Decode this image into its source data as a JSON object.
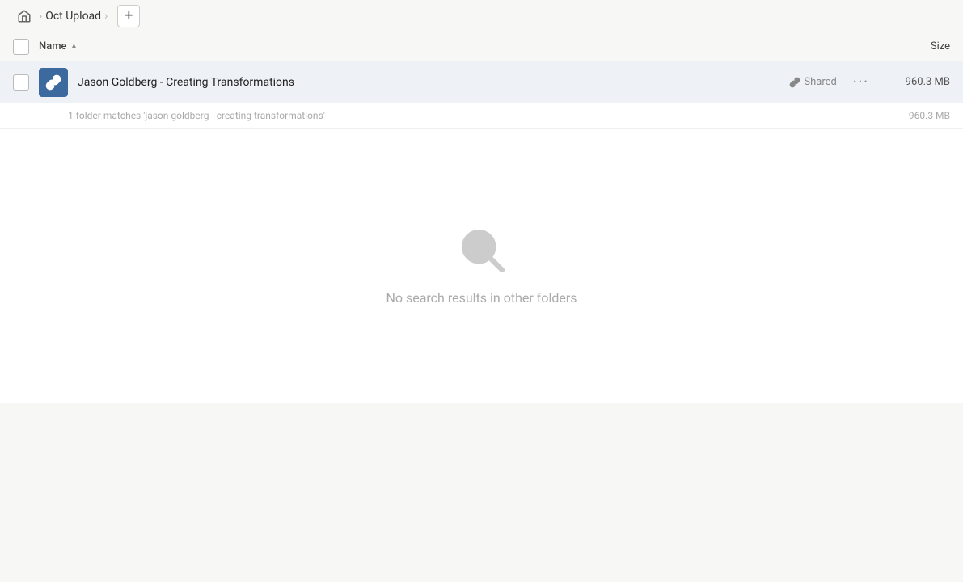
{
  "breadcrumb": {
    "home_label": "Home",
    "separator": "›",
    "current_folder": "Oct Upload",
    "add_button_label": "+"
  },
  "columns": {
    "name_label": "Name",
    "sort_indicator": "▲",
    "size_label": "Size"
  },
  "file_row": {
    "name": "Jason Goldberg - Creating Transformations",
    "shared_label": "Shared",
    "size": "960.3 MB",
    "icon_type": "link-icon"
  },
  "summary": {
    "text": "1 folder matches 'jason goldberg - creating transformations'",
    "size": "960.3 MB"
  },
  "empty_state": {
    "icon": "search-icon",
    "message": "No search results in other folders"
  }
}
